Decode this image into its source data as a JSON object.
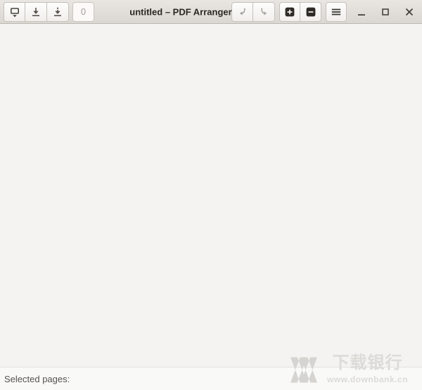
{
  "window": {
    "title": "untitled – PDF Arranger",
    "controls": {
      "minimize": "minimize",
      "maximize": "maximize",
      "close": "close"
    }
  },
  "toolbar": {
    "open_button": {
      "icon_name": "document-open-dropdown-icon"
    },
    "save_button": {
      "icon_name": "save-download-icon"
    },
    "import_button": {
      "icon_name": "import-download-dashed-icon"
    },
    "page_entry": {
      "value": "0",
      "disabled": true
    },
    "undo_button": {
      "icon_name": "undo-arrow-icon",
      "disabled": true
    },
    "redo_button": {
      "icon_name": "redo-arrow-icon",
      "disabled": true
    },
    "zoom_in_button": {
      "icon_name": "zoom-in-square-icon"
    },
    "zoom_out_button": {
      "icon_name": "zoom-out-square-icon"
    },
    "menu_button": {
      "icon_name": "hamburger-menu-icon"
    }
  },
  "statusbar": {
    "label": "Selected pages:"
  },
  "watermark": {
    "logo": "double-x-logo",
    "title": "下载银行",
    "url": "www.downbank.cn"
  },
  "colors": {
    "headerbar_bg_top": "#e9e6e2",
    "headerbar_bg_bottom": "#dad7d2",
    "headerbar_border": "#bdb8b2",
    "content_bg": "#f4f3f1",
    "statusbar_bg": "#f9f9f8",
    "button_border": "#c6c1bb",
    "title_text": "#2b2824",
    "icon_dark": "#49453f",
    "icon_disabled": "#a8a49e",
    "zoom_icon_fill": "#2e2b27",
    "watermark_gray": "#dcdbd7"
  }
}
